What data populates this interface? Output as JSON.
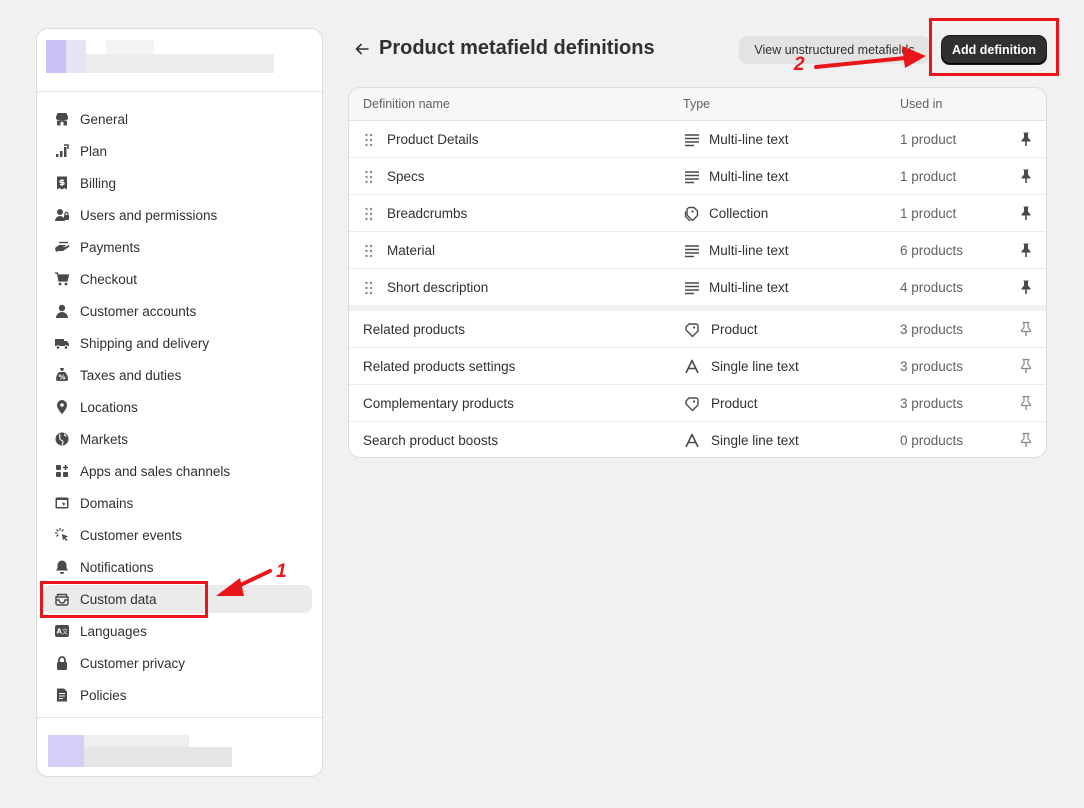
{
  "sidebar": {
    "items": [
      {
        "label": "General",
        "icon": "store-icon"
      },
      {
        "label": "Plan",
        "icon": "chart-icon"
      },
      {
        "label": "Billing",
        "icon": "receipt-icon"
      },
      {
        "label": "Users and permissions",
        "icon": "users-icon"
      },
      {
        "label": "Payments",
        "icon": "payment-hand-icon"
      },
      {
        "label": "Checkout",
        "icon": "cart-icon"
      },
      {
        "label": "Customer accounts",
        "icon": "person-icon"
      },
      {
        "label": "Shipping and delivery",
        "icon": "truck-icon"
      },
      {
        "label": "Taxes and duties",
        "icon": "money-bag-icon"
      },
      {
        "label": "Locations",
        "icon": "location-pin-icon"
      },
      {
        "label": "Markets",
        "icon": "globe-icon"
      },
      {
        "label": "Apps and sales channels",
        "icon": "apps-icon"
      },
      {
        "label": "Domains",
        "icon": "domain-icon"
      },
      {
        "label": "Customer events",
        "icon": "cursor-click-icon"
      },
      {
        "label": "Notifications",
        "icon": "bell-icon"
      },
      {
        "label": "Custom data",
        "icon": "database-icon",
        "active": true
      },
      {
        "label": "Languages",
        "icon": "translate-icon"
      },
      {
        "label": "Customer privacy",
        "icon": "lock-icon"
      },
      {
        "label": "Policies",
        "icon": "document-icon"
      }
    ]
  },
  "header": {
    "title": "Product metafield definitions",
    "secondary_label": "View unstructured metafields",
    "primary_label": "Add definition"
  },
  "table": {
    "columns": [
      "Definition name",
      "Type",
      "Used in"
    ],
    "pinned_rows": [
      {
        "name": "Product Details",
        "type": "Multi-line text",
        "type_icon": "text-lines-icon",
        "used": "1 product"
      },
      {
        "name": "Specs",
        "type": "Multi-line text",
        "type_icon": "text-lines-icon",
        "used": "1 product"
      },
      {
        "name": "Breadcrumbs",
        "type": "Collection",
        "type_icon": "collection-icon",
        "used": "1 product"
      },
      {
        "name": "Material",
        "type": "Multi-line text",
        "type_icon": "text-lines-icon",
        "used": "6 products"
      },
      {
        "name": "Short description",
        "type": "Multi-line text",
        "type_icon": "text-lines-icon",
        "used": "4 products"
      }
    ],
    "unpinned_rows": [
      {
        "name": "Related products",
        "type": "Product",
        "type_icon": "product-tag-icon",
        "used": "3 products"
      },
      {
        "name": "Related products settings",
        "type": "Single line text",
        "type_icon": "font-a-icon",
        "used": "3 products"
      },
      {
        "name": "Complementary products",
        "type": "Product",
        "type_icon": "product-tag-icon",
        "used": "3 products"
      },
      {
        "name": "Search product boosts",
        "type": "Single line text",
        "type_icon": "font-a-icon",
        "used": "0 products"
      }
    ]
  },
  "annotations": {
    "step1": "1",
    "step2": "2",
    "color": "#e8161b"
  }
}
